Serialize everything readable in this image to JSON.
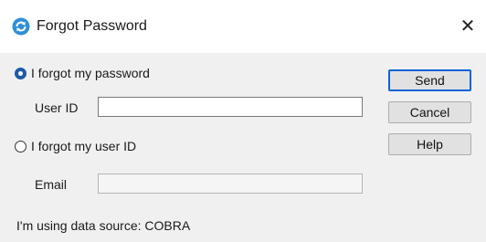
{
  "window": {
    "title": "Forgot Password",
    "icon": "refresh-circle-icon",
    "close_glyph": "✕"
  },
  "options": {
    "forgot_password": {
      "label": "I forgot my password",
      "selected": true,
      "user_id_label": "User ID",
      "user_id_value": ""
    },
    "forgot_user_id": {
      "label": "I forgot my user ID",
      "selected": false,
      "email_label": "Email",
      "email_value": ""
    }
  },
  "buttons": {
    "send": "Send",
    "cancel": "Cancel",
    "help": "Help"
  },
  "footer": {
    "data_source_text": "I'm using data source: COBRA"
  },
  "colors": {
    "accent": "#1e5aa8",
    "icon_blue": "#2f8fd8",
    "default_button_border": "#0f62d6"
  }
}
